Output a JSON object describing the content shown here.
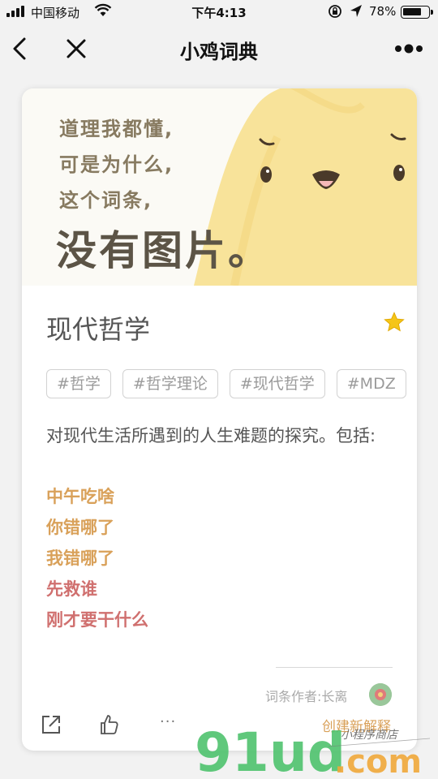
{
  "status_bar": {
    "carrier": "中国移动",
    "time": "下午4:13",
    "battery_percent_text": "78%",
    "battery_level": 0.78
  },
  "nav": {
    "title": "小鸡词典",
    "icons": [
      "back-icon",
      "close-icon",
      "more-icon"
    ]
  },
  "banner": {
    "line1": "道理我都懂,",
    "line2": "可是为什么,",
    "line3": "这个词条,",
    "big": "没有图片。"
  },
  "entry": {
    "word": "现代哲学",
    "favorited": true,
    "tags": [
      "#哲学",
      "#哲学理论",
      "#现代哲学",
      "#MDZ"
    ],
    "description": "对现代生活所遇到的人生难题的探究。包括:",
    "items": [
      {
        "text": "中午吃啥",
        "color": "#d9a15a"
      },
      {
        "text": "你错哪了",
        "color": "#d9a15a"
      },
      {
        "text": "我错哪了",
        "color": "#d9a15a"
      },
      {
        "text": "先救谁",
        "color": "#d0706f"
      },
      {
        "text": "刚才要干什么",
        "color": "#d0706f"
      }
    ]
  },
  "footer": {
    "author_label": "词条作者:长离",
    "actions": {
      "share_icon": "share-icon",
      "like_icon": "thumbs-up-icon",
      "more_text": "···"
    },
    "create_label": "创建新解释"
  },
  "watermark": {
    "text": "91ud.com",
    "subtext": "小程序商店"
  },
  "colors": {
    "accent_gold": "#d9a15a",
    "accent_red": "#d0706f",
    "chick_yellow": "#f8e39a",
    "watermark_green": "#4fc36e"
  }
}
